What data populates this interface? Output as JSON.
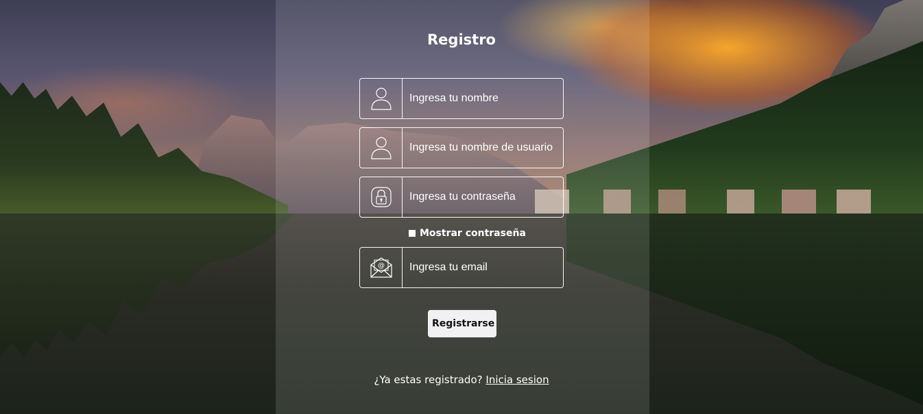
{
  "form": {
    "title": "Registro",
    "fields": {
      "nombre": {
        "placeholder": "Ingresa tu nombre",
        "icon": "user-icon"
      },
      "usuario": {
        "placeholder": "Ingresa tu nombre de usuario",
        "icon": "user-icon"
      },
      "password": {
        "placeholder": "Ingresa tu contraseña",
        "icon": "lock-icon"
      },
      "email": {
        "placeholder": "Ingresa tu email",
        "icon": "mail-icon"
      }
    },
    "show_password_label": "Mostrar contraseña",
    "submit_label": "Registrarse",
    "login_prompt": "¿Ya estas registrado?",
    "login_link": "Inicia sesion"
  }
}
